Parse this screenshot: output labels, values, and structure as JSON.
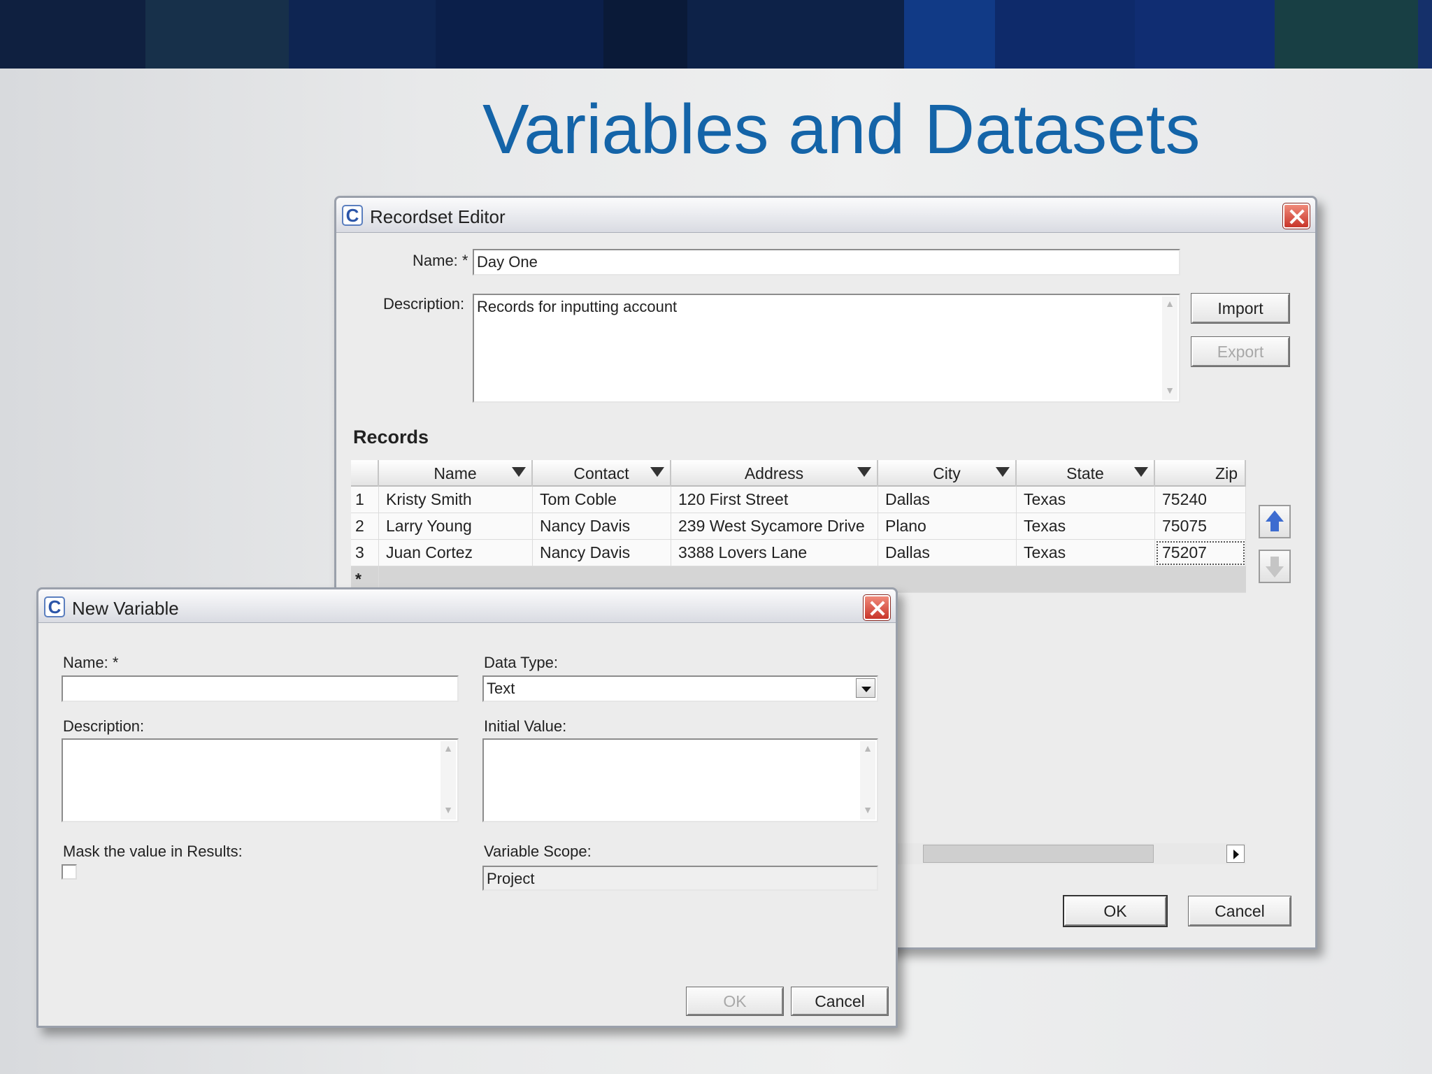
{
  "slide": {
    "title": "Variables and Datasets"
  },
  "recordset_editor": {
    "title": "Recordset Editor",
    "name_label": "Name: *",
    "name_value": "Day One",
    "description_label": "Description:",
    "description_value": "Records for inputting account",
    "import_label": "Import",
    "export_label": "Export",
    "records_heading": "Records",
    "columns": [
      "Name",
      "Contact",
      "Address",
      "City",
      "State",
      "Zip"
    ],
    "rows": [
      {
        "num": "1",
        "name": "Kristy Smith",
        "contact": "Tom Coble",
        "address": "120 First Street",
        "city": "Dallas",
        "state": "Texas",
        "zip": "75240"
      },
      {
        "num": "2",
        "name": "Larry Young",
        "contact": "Nancy Davis",
        "address": "239 West Sycamore Drive",
        "city": "Plano",
        "state": "Texas",
        "zip": "75075"
      },
      {
        "num": "3",
        "name": "Juan Cortez",
        "contact": "Nancy Davis",
        "address": "3388 Lovers Lane",
        "city": "Dallas",
        "state": "Texas",
        "zip": "75207"
      }
    ],
    "new_row_marker": "*",
    "ok_label": "OK",
    "cancel_label": "Cancel"
  },
  "new_variable": {
    "title": "New Variable",
    "name_label": "Name: *",
    "name_value": "",
    "data_type_label": "Data Type:",
    "data_type_value": "Text",
    "description_label": "Description:",
    "initial_value_label": "Initial Value:",
    "mask_label": "Mask the value in Results:",
    "scope_label": "Variable Scope:",
    "scope_value": "Project",
    "ok_label": "OK",
    "cancel_label": "Cancel"
  },
  "colors": {
    "title": "#1464a8",
    "close": "#c8352a",
    "arrow_up": "#3d6cd0"
  }
}
